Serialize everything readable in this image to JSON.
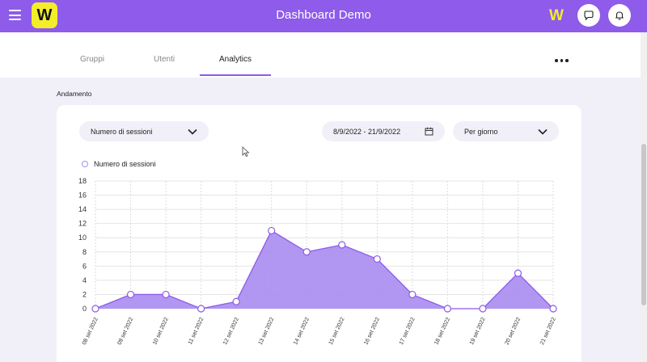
{
  "header": {
    "title": "Dashboard Demo",
    "logo_text": "W",
    "brand_mark": "W",
    "icons": [
      "menu-icon",
      "chat-icon",
      "bell-icon"
    ],
    "accent_color": "#8e5bea",
    "logo_color": "#f2ee2a"
  },
  "tabs": [
    {
      "label": "Gruppi",
      "active": false
    },
    {
      "label": "Utenti",
      "active": false
    },
    {
      "label": "Analytics",
      "active": true
    }
  ],
  "section": {
    "title": "Andamento"
  },
  "filters": {
    "metric": "Numero di sessioni",
    "date_range": "8/9/2022 - 21/9/2022",
    "granularity": "Per giorno"
  },
  "chart_data": {
    "type": "area",
    "series": [
      {
        "name": "Numero di sessioni",
        "values": [
          0,
          2,
          2,
          0,
          1,
          11,
          8,
          9,
          7,
          2,
          0,
          0,
          5,
          0
        ]
      }
    ],
    "categories": [
      "08 set 2022",
      "09 set 2022",
      "10 set 2022",
      "11 set 2022",
      "12 set 2022",
      "13 set 2022",
      "14 set 2022",
      "15 set 2022",
      "16 set 2022",
      "17 set 2022",
      "18 set 2022",
      "19 set 2022",
      "20 set 2022",
      "21 set 2022"
    ],
    "yticks": [
      0,
      2,
      4,
      6,
      8,
      10,
      12,
      14,
      16,
      18
    ],
    "ylim": [
      0,
      18
    ],
    "grid": true,
    "legend": "top-left",
    "fill_color": "#a98cf0",
    "line_color": "#8e5bea"
  }
}
